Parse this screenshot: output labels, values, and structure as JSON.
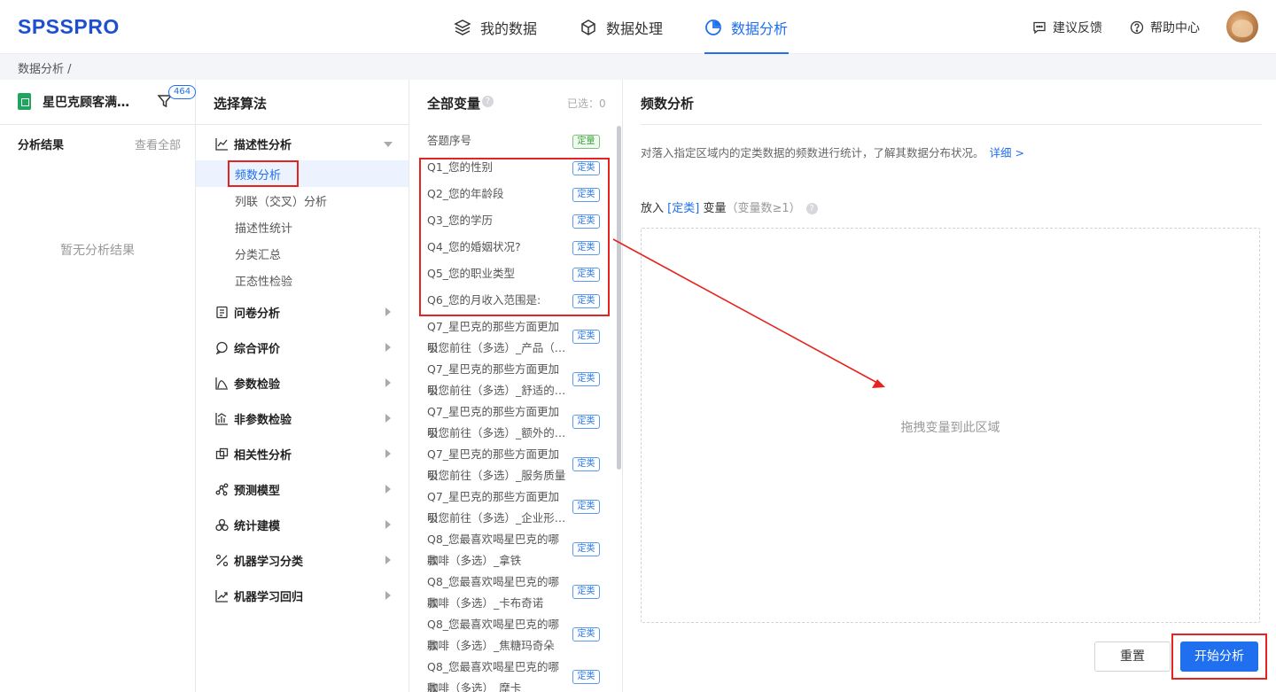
{
  "logo": "SPSSPRO",
  "nav": {
    "my_data": "我的数据",
    "data_processing": "数据处理",
    "data_analysis": "数据分析",
    "feedback": "建议反馈",
    "help": "帮助中心"
  },
  "breadcrumb": "数据分析 /",
  "results_panel": {
    "file_title": "星巴克顾客满…",
    "filter_badge": "464",
    "label": "分析结果",
    "view_all": "查看全部",
    "empty": "暂无分析结果"
  },
  "algorithm_panel": {
    "title": "选择算法",
    "categories": [
      {
        "label": "描述性分析",
        "icon": "line-chart-icon",
        "expanded": true,
        "children": [
          "频数分析",
          "列联（交叉）分析",
          "描述性统计",
          "分类汇总",
          "正态性检验"
        ]
      },
      {
        "label": "问卷分析",
        "icon": "questionnaire-icon"
      },
      {
        "label": "综合评价",
        "icon": "chat-bubble-icon"
      },
      {
        "label": "参数检验",
        "icon": "curve-icon"
      },
      {
        "label": "非参数检验",
        "icon": "bar-chart-icon"
      },
      {
        "label": "相关性分析",
        "icon": "overlap-squares-icon"
      },
      {
        "label": "预测模型",
        "icon": "network-icon"
      },
      {
        "label": "统计建模",
        "icon": "circles-icon"
      },
      {
        "label": "机器学习分类",
        "icon": "percent-icon"
      },
      {
        "label": "机器学习回归",
        "icon": "trend-icon"
      }
    ],
    "selected": "频数分析"
  },
  "variables_panel": {
    "title": "全部变量",
    "selected_count": "已选：0",
    "variables": [
      {
        "lines": [
          "答题序号"
        ],
        "tag": "定量"
      },
      {
        "lines": [
          "Q1_您的性别"
        ],
        "tag": "定类"
      },
      {
        "lines": [
          "Q2_您的年龄段"
        ],
        "tag": "定类"
      },
      {
        "lines": [
          "Q3_您的学历"
        ],
        "tag": "定类"
      },
      {
        "lines": [
          "Q4_您的婚姻状况?"
        ],
        "tag": "定类"
      },
      {
        "lines": [
          "Q5_您的职业类型"
        ],
        "tag": "定类"
      },
      {
        "lines": [
          "Q6_您的月收入范围是:"
        ],
        "tag": "定类"
      },
      {
        "lines": [
          "Q7_星巴克的那些方面更加吸",
          "引您前往（多选）_产品（…"
        ],
        "tag": "定类"
      },
      {
        "lines": [
          "Q7_星巴克的那些方面更加吸",
          "引您前往（多选）_舒适的…"
        ],
        "tag": "定类"
      },
      {
        "lines": [
          "Q7_星巴克的那些方面更加吸",
          "引您前往（多选）_额外的…"
        ],
        "tag": "定类"
      },
      {
        "lines": [
          "Q7_星巴克的那些方面更加吸",
          "引您前往（多选）_服务质量"
        ],
        "tag": "定类"
      },
      {
        "lines": [
          "Q7_星巴克的那些方面更加吸",
          "引您前往（多选）_企业形…"
        ],
        "tag": "定类"
      },
      {
        "lines": [
          "Q8_您最喜欢喝星巴克的哪款",
          "咖啡（多选）_拿铁"
        ],
        "tag": "定类"
      },
      {
        "lines": [
          "Q8_您最喜欢喝星巴克的哪款",
          "咖啡（多选）_卡布奇诺"
        ],
        "tag": "定类"
      },
      {
        "lines": [
          "Q8_您最喜欢喝星巴克的哪款",
          "咖啡（多选）_焦糖玛奇朵"
        ],
        "tag": "定类"
      },
      {
        "lines": [
          "Q8_您最喜欢喝星巴克的哪款",
          "咖啡（多选）_摩卡"
        ],
        "tag": "定类"
      }
    ]
  },
  "config_panel": {
    "title": "频数分析",
    "description": "对落入指定区域内的定类数据的频数进行统计，了解其数据分布状况。",
    "detail_link": "详细 >",
    "put_prefix": "放入",
    "put_type": "[定类]",
    "put_suffix": "变量",
    "put_hint": "（变量数≥1）",
    "drop_hint": "拖拽变量到此区域",
    "reset": "重置",
    "start": "开始分析"
  },
  "colors": {
    "accent": "#1f6fee",
    "annotation_red": "#e6241f",
    "tag_green": "#3ba23d"
  }
}
